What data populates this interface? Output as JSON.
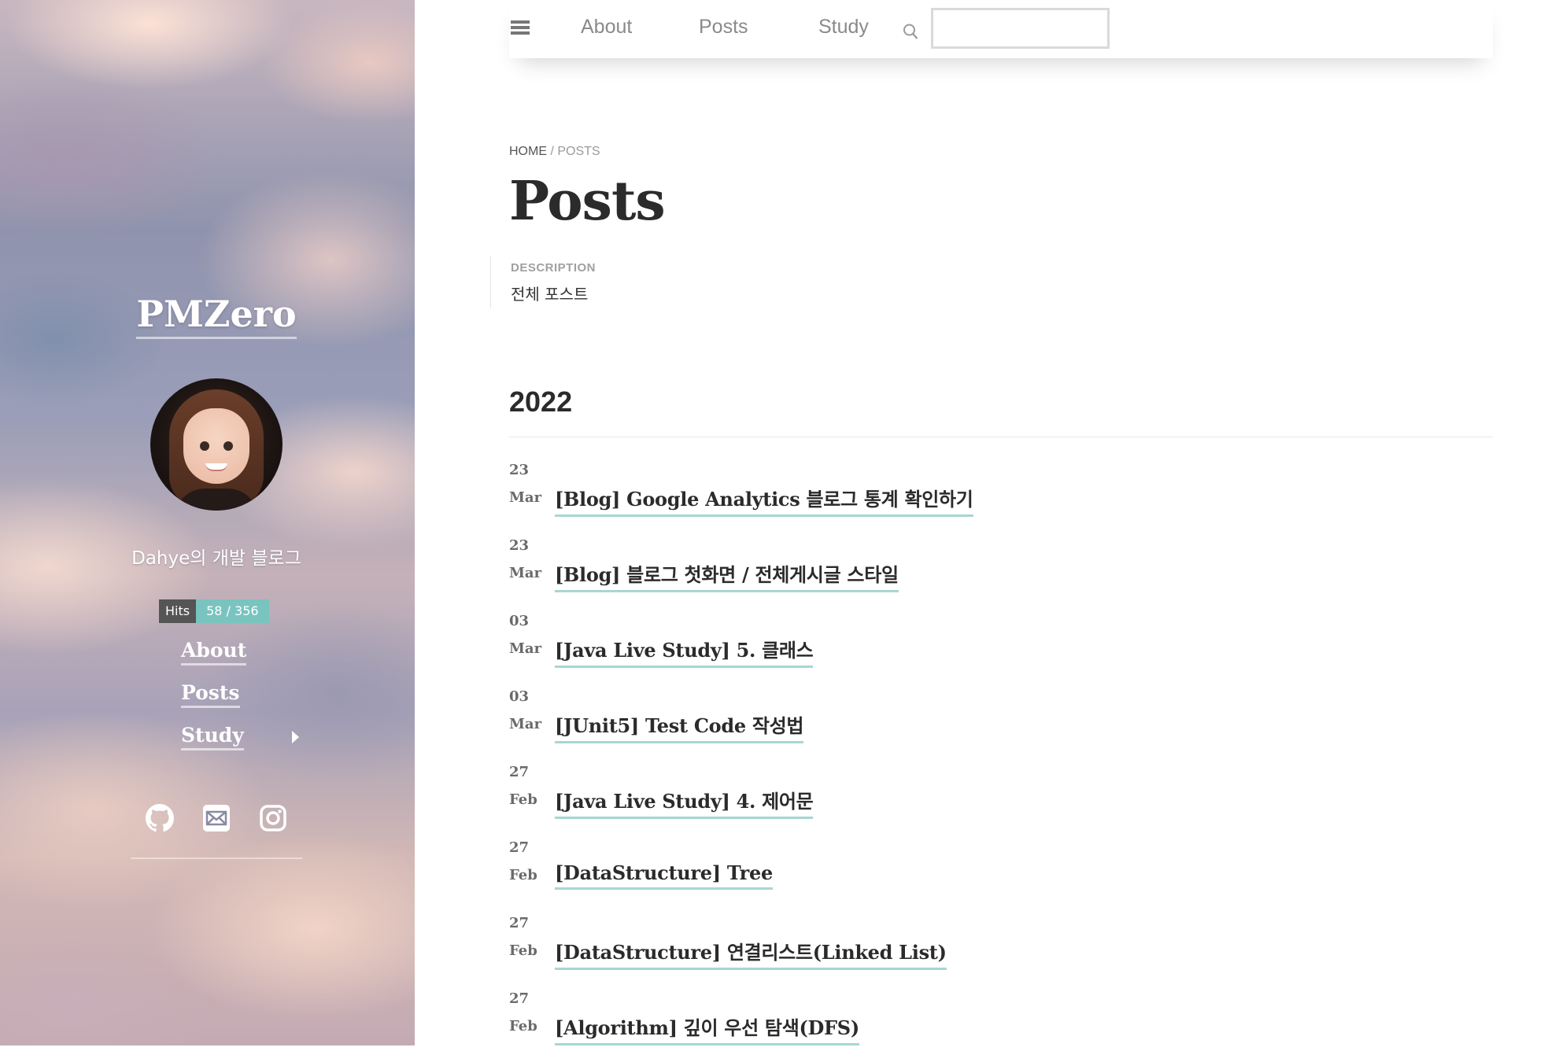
{
  "sidebar": {
    "site_title": "PMZero",
    "subtitle": "Dahye의 개발 블로그",
    "hits": {
      "label": "Hits",
      "value": "58 / 356"
    },
    "nav": [
      {
        "label": "About"
      },
      {
        "label": "Posts"
      },
      {
        "label": "Study"
      }
    ],
    "social": [
      "github-icon",
      "mail-icon",
      "instagram-icon"
    ]
  },
  "topnav": {
    "links": [
      "About",
      "Posts",
      "Study"
    ],
    "search": {
      "value": "",
      "placeholder": ""
    }
  },
  "breadcrumb": {
    "home": "HOME",
    "separator": "/",
    "current": "POSTS"
  },
  "page": {
    "title": "Posts",
    "description_label": "DESCRIPTION",
    "description": "전체 포스트"
  },
  "archive": {
    "year": "2022",
    "posts": [
      {
        "day": "23",
        "month": "Mar",
        "title": "[Blog] Google Analytics 블로그 통계 확인하기"
      },
      {
        "day": "23",
        "month": "Mar",
        "title": "[Blog] 블로그 첫화면 / 전체게시글 스타일"
      },
      {
        "day": "03",
        "month": "Mar",
        "title": "[Java Live Study] 5. 클래스"
      },
      {
        "day": "03",
        "month": "Mar",
        "title": "[JUnit5] Test Code 작성법"
      },
      {
        "day": "27",
        "month": "Feb",
        "title": "[Java Live Study] 4. 제어문"
      },
      {
        "day": "27",
        "month": "Feb",
        "title": "[DataStructure] Tree"
      },
      {
        "day": "27",
        "month": "Feb",
        "title": "[DataStructure] 연결리스트(Linked List)"
      },
      {
        "day": "27",
        "month": "Feb",
        "title": "[Algorithm] 깊이 우선 탐색(DFS)"
      }
    ]
  },
  "colors": {
    "accent_underline": "#a6d7d3",
    "hits_value_bg": "#79c4bf",
    "text_dark": "#2b2b2b"
  }
}
